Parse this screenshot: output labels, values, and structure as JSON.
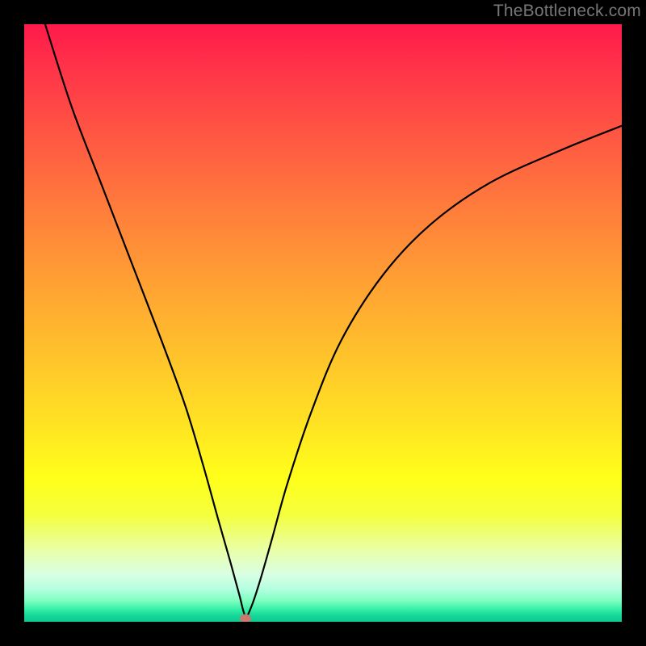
{
  "watermark": "TheBottleneck.com",
  "marker": {
    "x_pct": 37.0,
    "y_pct": 99.4
  },
  "colors": {
    "frame": "#000000",
    "curve": "#000000",
    "marker": "#c97a6c",
    "watermark": "#777777"
  },
  "chart_data": {
    "type": "line",
    "title": "",
    "xlabel": "",
    "ylabel": "",
    "xlim": [
      0,
      100
    ],
    "ylim": [
      0,
      100
    ],
    "grid": false,
    "legend": false,
    "background_gradient": [
      {
        "stop": 0,
        "color": "#ff1a4b"
      },
      {
        "stop": 50,
        "color": "#ffcf2a"
      },
      {
        "stop": 80,
        "color": "#ffff1a"
      },
      {
        "stop": 100,
        "color": "#0ec890"
      }
    ],
    "series": [
      {
        "name": "curve",
        "x": [
          3.5,
          8,
          13,
          18,
          23,
          27,
          30,
          32.5,
          34.5,
          36,
          37,
          38,
          39.5,
          41.5,
          44,
          48,
          53,
          60,
          68,
          78,
          90,
          100
        ],
        "y": [
          100,
          86,
          73,
          60,
          47,
          36,
          26,
          17,
          10,
          4.5,
          1,
          2.5,
          7,
          14,
          23,
          35,
          47,
          58,
          66.5,
          73.5,
          79,
          83
        ]
      }
    ],
    "marker_point": {
      "x": 37,
      "y": 0.6
    }
  }
}
